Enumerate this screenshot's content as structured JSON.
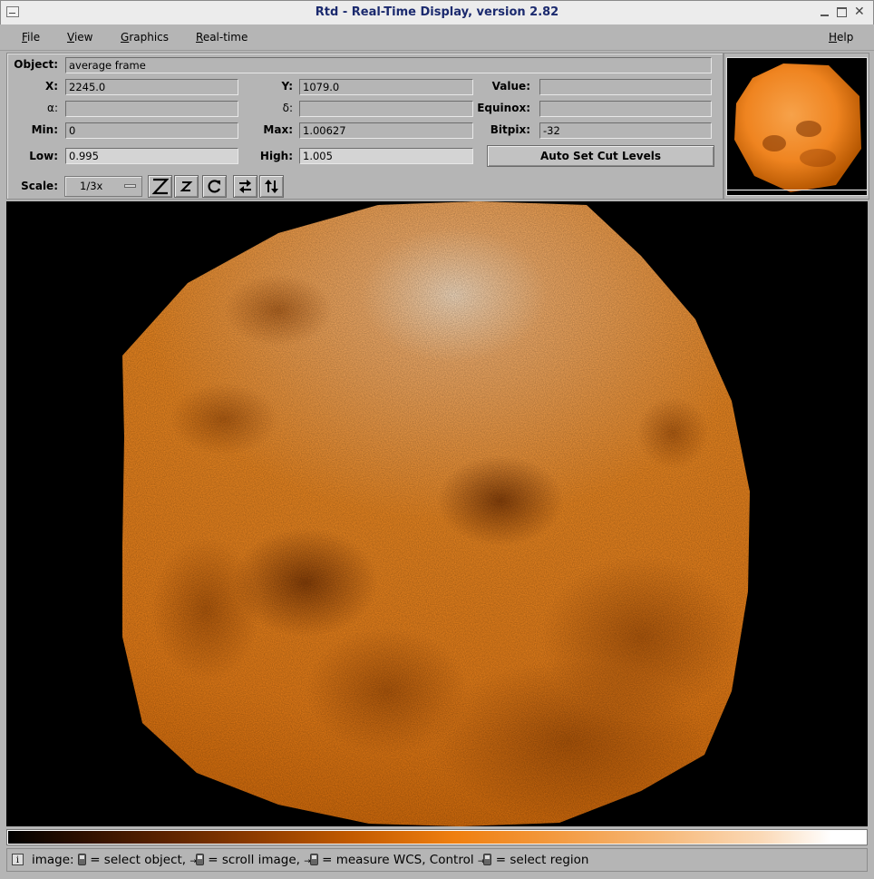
{
  "window": {
    "title": "Rtd - Real-Time Display, version 2.82"
  },
  "menubar": {
    "items": [
      {
        "label": "File",
        "ul": "F",
        "rest": "ile"
      },
      {
        "label": "View",
        "ul": "V",
        "rest": "iew"
      },
      {
        "label": "Graphics",
        "ul": "G",
        "rest": "raphics"
      },
      {
        "label": "Real-time",
        "ul": "R",
        "rest": "eal-time"
      }
    ],
    "help": {
      "label": "Help",
      "ul": "H",
      "rest": "elp"
    }
  },
  "panel": {
    "object": {
      "label": "Object:",
      "value": "average frame"
    },
    "x": {
      "label": "X:",
      "value": "2245.0"
    },
    "y": {
      "label": "Y:",
      "value": "1079.0"
    },
    "value": {
      "label": "Value:",
      "value": ""
    },
    "alpha": {
      "label": "α:",
      "value": ""
    },
    "delta": {
      "label": "δ:",
      "value": ""
    },
    "equinox": {
      "label": "Equinox:",
      "value": ""
    },
    "min": {
      "label": "Min:",
      "value": "0"
    },
    "max": {
      "label": "Max:",
      "value": "1.00627"
    },
    "bitpix": {
      "label": "Bitpix:",
      "value": "-32"
    },
    "low": {
      "label": "Low:",
      "value": "0.995"
    },
    "high": {
      "label": "High:",
      "value": "1.005"
    },
    "auto_cut_button": "Auto Set Cut Levels",
    "scale": {
      "label": "Scale:",
      "value": "1/3x"
    }
  },
  "toolbar": {
    "icons": [
      "zoom-in-icon",
      "zoom-out-icon",
      "rotate-icon",
      "flip-x-icon",
      "flip-y-icon"
    ]
  },
  "colors": {
    "image_orange": "#f08a1e",
    "image_background": "#000000",
    "ui_gray": "#b5b5b5"
  },
  "colorbar": {
    "colormap": "heat (black→orange→white)"
  },
  "status": {
    "icon": "info-icon",
    "prefix": "image:",
    "p1": "= select object,",
    "p2": "= scroll image,",
    "p3": "= measure WCS, Control",
    "p4": "= select region"
  }
}
